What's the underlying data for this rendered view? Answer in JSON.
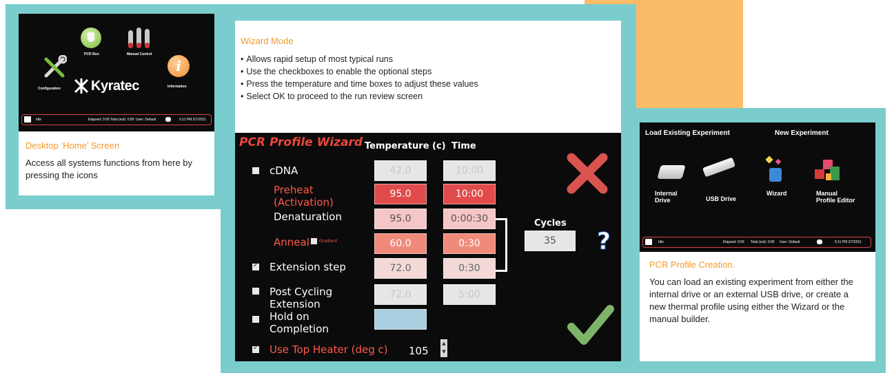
{
  "home": {
    "caption_title": "Desktop ‘Home’ Screen",
    "caption_body": "Access all systems functions from here by pressing the icons",
    "icons": {
      "pcr_run": "PCR Run",
      "manual_control": "Manual Control",
      "configuration": "Configuration",
      "information": "Information"
    },
    "logo": "Kyratec",
    "status": {
      "state": "Idle",
      "elapsed": "Elapsed: 0:00",
      "total": "Total (est): 0:00",
      "user": "User: Default",
      "time": "5:11 PM 2/7/2011"
    }
  },
  "wizard": {
    "title": "Wizard Mode",
    "bullets": [
      "Allows rapid setup of most typical runs",
      "Use the checkboxes to enable the optional steps",
      "Press the temperature and time boxes to adjust these values",
      "Select OK to proceed to the run review screen"
    ],
    "screen": {
      "title": "PCR Profile Wizard",
      "col_temperature": "Temperature (c)",
      "col_time": "Time",
      "cycles_label": "Cycles",
      "cycles_value": "35",
      "gradient_label": "Gradient",
      "top_heater_label": "Use Top Heater (deg c)",
      "top_heater_value": "105",
      "steps": [
        {
          "label": "cDNA",
          "temp": "42.0",
          "time": "10:00"
        },
        {
          "label": "Preheat (Activation)",
          "temp": "95.0",
          "time": "10:00"
        },
        {
          "label": "Denaturation",
          "temp": "95.0",
          "time": "0:00:30"
        },
        {
          "label": "Anneal",
          "temp": "60.0",
          "time": "0:30"
        },
        {
          "label": "Extension step",
          "temp": "72.0",
          "time": "0:30"
        },
        {
          "label": "Post Cycling Extension",
          "temp": "72.0",
          "time": "5:00"
        },
        {
          "label": "Hold on Completion",
          "temp": "",
          "time": ""
        }
      ]
    }
  },
  "creation": {
    "load_heading": "Load Existing Experiment",
    "new_heading": "New Experiment",
    "items": {
      "internal_drive": "Internal Drive",
      "usb_drive": "USB Drive",
      "wizard": "Wizard",
      "manual_editor": "Manual Profile Editor"
    },
    "status": {
      "state": "Idle",
      "elapsed": "Elapsed: 0:00",
      "total": "Total (est): 0:00",
      "user": "User: Default",
      "time": "5:11 PM 2/7/2011"
    },
    "caption_title": "PCR Profile Creation.",
    "caption_body": "You can load an existing experiment from either the internal drive or an external USB drive, or create a new thermal profile using either the Wizard or the manual builder."
  },
  "colors": {
    "teal": "#7bcdcd",
    "orange": "#fcbb69",
    "accent": "#f39a2c"
  }
}
